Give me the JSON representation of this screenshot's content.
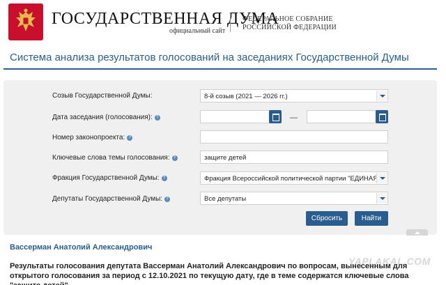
{
  "header": {
    "title": "ГОСУДАРСТВЕННАЯ ДУМА",
    "subtitle": "официальный сайт",
    "federal_line1": "ФЕДЕРАЛЬНОЕ СОБРАНИЕ",
    "federal_line2": "РОССИЙСКОЙ ФЕДЕРАЦИИ"
  },
  "page_title": "Система анализа результатов голосований на заседаниях Государственной Думы",
  "form": {
    "convocation_label": "Созыв Государственной Думы:",
    "convocation_value": "8-й созыв (2021 — 2026 гг.)",
    "date_label": "Дата заседания (голосования):",
    "date_separator": "—",
    "bill_label": "Номер законопроекта:",
    "keywords_label": "Ключевые слова темы голосования:",
    "keywords_value": "защите детей",
    "faction_label": "Фракция Государственной Думы:",
    "faction_value": "Фракция Всероссийской политической партии \"ЕДИНАЯ",
    "deputies_label": "Депутаты Государственной Думы:",
    "deputies_value": "Все депутаты",
    "reset_label": "Сбросить",
    "find_label": "Найти",
    "help_glyph": "?"
  },
  "result": {
    "deputy_name": "Вассерман Анатолий Александрович",
    "summary": "Результаты голосования депутата Вассерман Анатолий Александрович по вопросам, вынесенным для открытого голосования за период с 12.10.2021 по текущую дату, где в теме содержатся ключевые слова \"защите детей\"."
  },
  "watermark": "YAPLAKAL.COM",
  "colors": {
    "accent": "#2a5d8f",
    "emblem": "#c8102e",
    "panel": "#f0f0f0"
  },
  "icons": {
    "emblem": "double-headed-eagle-icon",
    "calendar": "calendar-icon",
    "dropdown": "chevron-down-icon",
    "help": "help-icon",
    "collapse": "chevron-up-icon"
  }
}
